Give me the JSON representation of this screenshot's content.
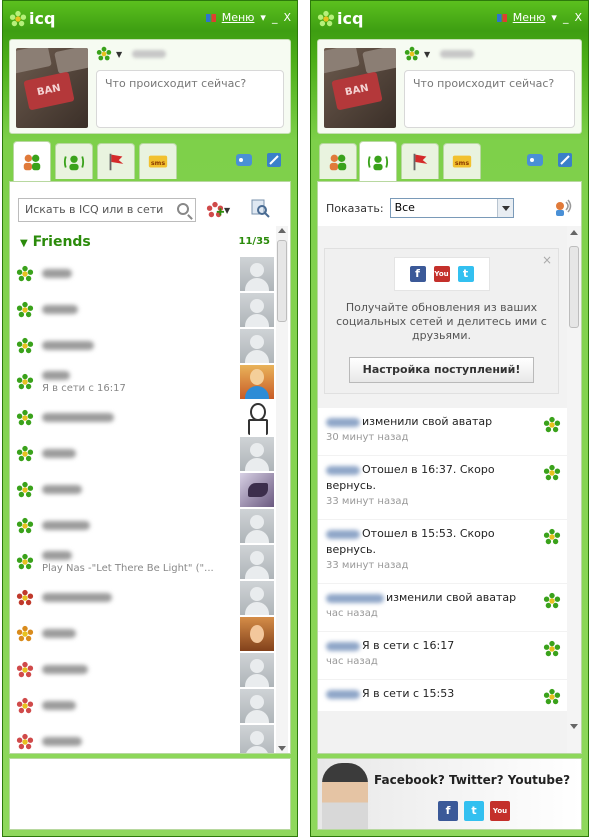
{
  "app": {
    "logo_text": "icq",
    "menu_label": "Меню",
    "menu_arrow": "▾",
    "minimize": "_",
    "close": "X"
  },
  "left": {
    "status_placeholder": "Что происходит сейчас?",
    "search_placeholder": "Искать в ICQ или в сети",
    "group_name": "Friends",
    "group_count": "11/35",
    "contacts": [
      {
        "status_color": "#3aa21b",
        "sub": "",
        "pic": "default"
      },
      {
        "status_color": "#3aa21b",
        "sub": "",
        "pic": "default"
      },
      {
        "status_color": "#3aa21b",
        "sub": "",
        "pic": "default"
      },
      {
        "status_color": "#3aa21b",
        "sub": "Я в сети с 16:17",
        "pic": "real1"
      },
      {
        "status_color": "#3aa21b",
        "sub": "",
        "pic": "real2"
      },
      {
        "status_color": "#3aa21b",
        "sub": "",
        "pic": "default"
      },
      {
        "status_color": "#3aa21b",
        "sub": "",
        "pic": "real3"
      },
      {
        "status_color": "#3aa21b",
        "sub": "",
        "pic": "default"
      },
      {
        "status_color": "#3aa21b",
        "sub": "Play Nas -\"Let There Be Light\" (\"...",
        "pic": "default"
      },
      {
        "status_color": "#c0392b",
        "sub": "",
        "pic": "default"
      },
      {
        "status_color": "#d98b1c",
        "sub": "",
        "pic": "real4"
      },
      {
        "status_color": "#d04a4a",
        "sub": "",
        "pic": "default"
      },
      {
        "status_color": "#d04a4a",
        "sub": "",
        "pic": "default"
      },
      {
        "status_color": "#d04a4a",
        "sub": "",
        "pic": "default"
      }
    ]
  },
  "right": {
    "status_placeholder": "Что происходит сейчас?",
    "show_label": "Показать:",
    "show_value": "Все",
    "promo": {
      "close": "×",
      "text": "Получайте обновления из ваших социальных сетей и делитесь ими с друзьями.",
      "button": "Настройка поступлений!",
      "fb": "f",
      "yt": "You",
      "tw": "t"
    },
    "feed": [
      {
        "text": "изменили свой аватар",
        "time": "30 минут назад"
      },
      {
        "text": "Отошел в 16:37. Скоро вернусь.",
        "time": "33 минут назад"
      },
      {
        "text": "Отошел в 15:53. Скоро вернусь.",
        "time": "33 минут назад"
      },
      {
        "text": "изменили свой аватар",
        "time": "час назад"
      },
      {
        "text": "Я в сети с 16:17",
        "time": "час назад"
      },
      {
        "text": "Я в сети с 15:53",
        "time": ""
      }
    ],
    "ad_text": "Facebook? Twitter? Youtube?"
  }
}
